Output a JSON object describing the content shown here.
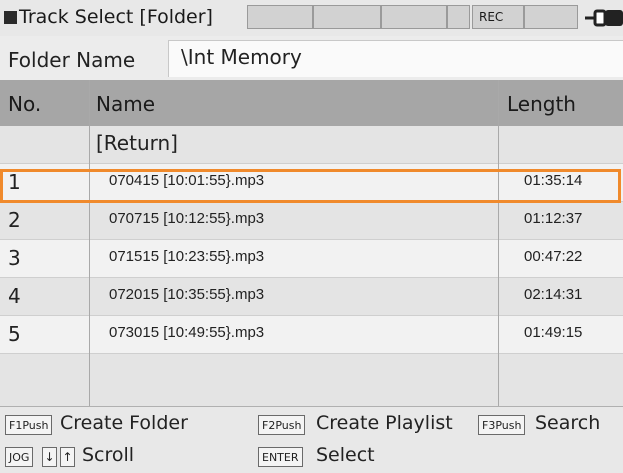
{
  "titlebar": {
    "title": "Track Select [Folder]",
    "rec_label": "REC",
    "battery_icon": "battery-icon"
  },
  "folder": {
    "label": "Folder Name",
    "value": "\\Int Memory"
  },
  "table": {
    "headers": {
      "no": "No.",
      "name": "Name",
      "length": "Length"
    },
    "return_label": "[Return]",
    "rows": [
      {
        "no": "1",
        "name": "070415 [10:01:55}.mp3",
        "length": "01:35:14"
      },
      {
        "no": "2",
        "name": "070715 [10:12:55}.mp3",
        "length": "01:12:37"
      },
      {
        "no": "3",
        "name": "071515 [10:23:55}.mp3",
        "length": "00:47:22"
      },
      {
        "no": "4",
        "name": "072015 [10:35:55}.mp3",
        "length": "02:14:31"
      },
      {
        "no": "5",
        "name": "073015 [10:49:55}.mp3",
        "length": "01:49:15"
      }
    ],
    "selected_index": 0
  },
  "help": {
    "f1_key": "F1Push",
    "f1_text": "Create Folder",
    "f2_key": "F2Push",
    "f2_text": "Create Playlist",
    "f3_key": "F3Push",
    "f3_text": "Search",
    "jog_key": "JOG",
    "down_key": "↓",
    "up_key": "↑",
    "scroll_text": "Scroll",
    "enter_key": "ENTER",
    "select_text": "Select"
  },
  "colors": {
    "selection_outline": "#f08a2c",
    "header_bg": "#a6a6a6"
  }
}
